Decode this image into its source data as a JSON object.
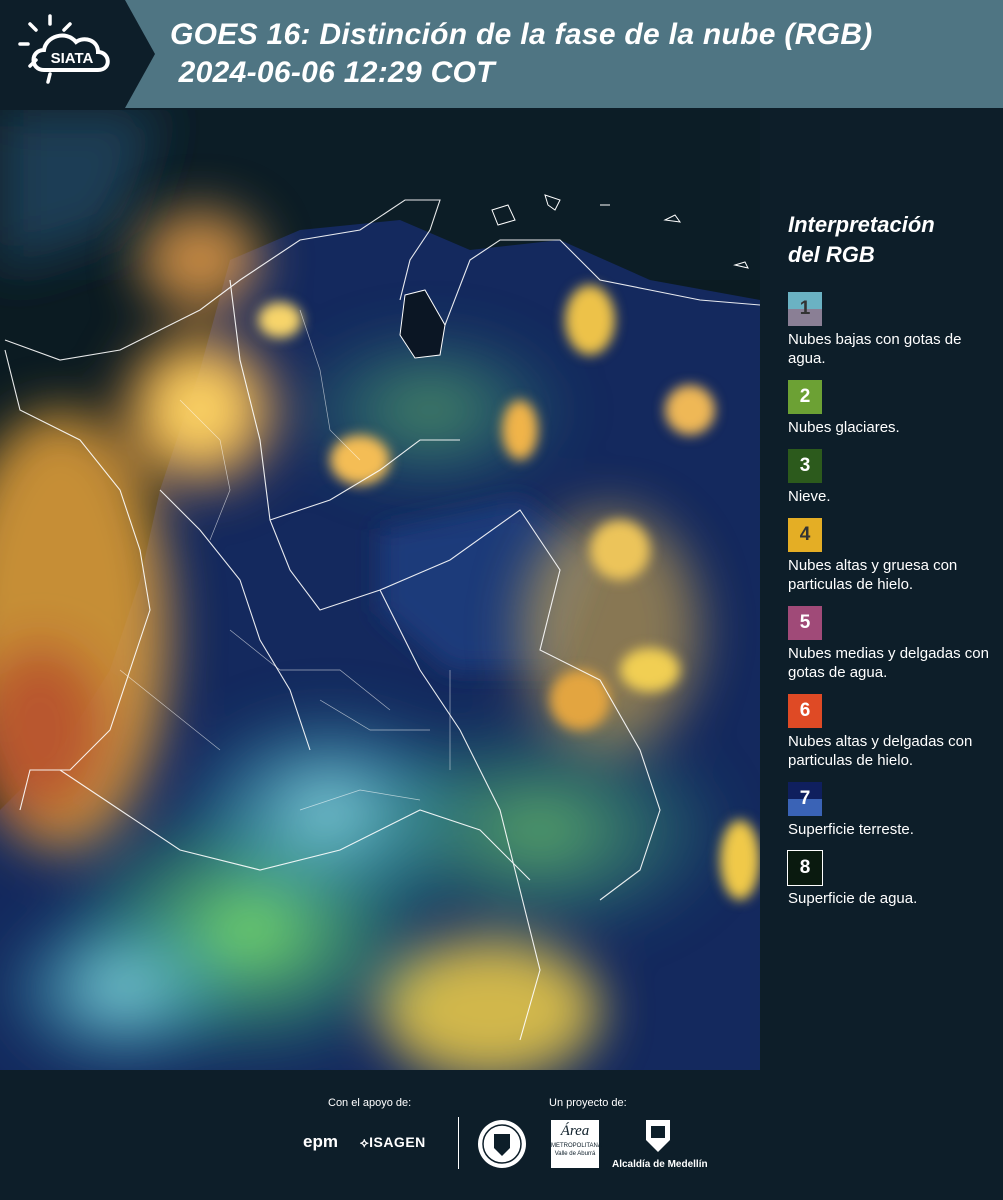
{
  "header": {
    "logo_text": "SIATA",
    "title_line1": "GOES 16: Distinción de la fase de la nube (RGB)",
    "title_line2": " 2024-06-06 12:29 COT"
  },
  "legend": {
    "title_line1": "Interpretación",
    "title_line2": "del RGB",
    "items": [
      {
        "num": "1",
        "label": "Nubes bajas con gotas de agua.",
        "color_top": "#6bb2c3",
        "color_bottom": "#8a7f95",
        "num_color": "#333333"
      },
      {
        "num": "2",
        "label": "Nubes glaciares.",
        "color_top": "#6ca134",
        "color_bottom": "#6ca134",
        "num_color": "#ffffff"
      },
      {
        "num": "3",
        "label": "Nieve.",
        "color_top": "#2c5a1c",
        "color_bottom": "#2c5a1c",
        "num_color": "#ffffff"
      },
      {
        "num": "4",
        "label": "Nubes altas y gruesa con particulas de hielo.",
        "color_top": "#e4ae25",
        "color_bottom": "#e4ae25",
        "num_color": "#333333"
      },
      {
        "num": "5",
        "label": "Nubes medias y delgadas con gotas de agua.",
        "color_top": "#a04a78",
        "color_bottom": "#a04a78",
        "num_color": "#ffffff"
      },
      {
        "num": "6",
        "label": "Nubes altas y delgadas con particulas de hielo.",
        "color_top": "#df4a25",
        "color_bottom": "#df4a25",
        "num_color": "#ffffff"
      },
      {
        "num": "7",
        "label": "Superficie terreste.",
        "color_top": "#0f1f5e",
        "color_bottom": "#3a63b6",
        "num_color": "#ffffff"
      },
      {
        "num": "8",
        "label": "Superficie de agua.",
        "color_top": "#0a1a0f",
        "color_bottom": "#0a1a0f",
        "num_color": "#ffffff"
      }
    ]
  },
  "footer": {
    "support_label": "Con el apoyo de:",
    "project_label": "Un proyecto de:",
    "sponsor1": "epm",
    "sponsor2": "ISAGEN",
    "partner_area": "Área",
    "partner_area_sub1": "METROPOLITANA",
    "partner_area_sub2": "Valle de Aburrá",
    "partner_medellin": "Alcaldía de Medellín"
  },
  "colors": {
    "header_bg": "#4f7583",
    "logo_bg": "#0d1e29",
    "page_bg": "#0d1e29"
  }
}
